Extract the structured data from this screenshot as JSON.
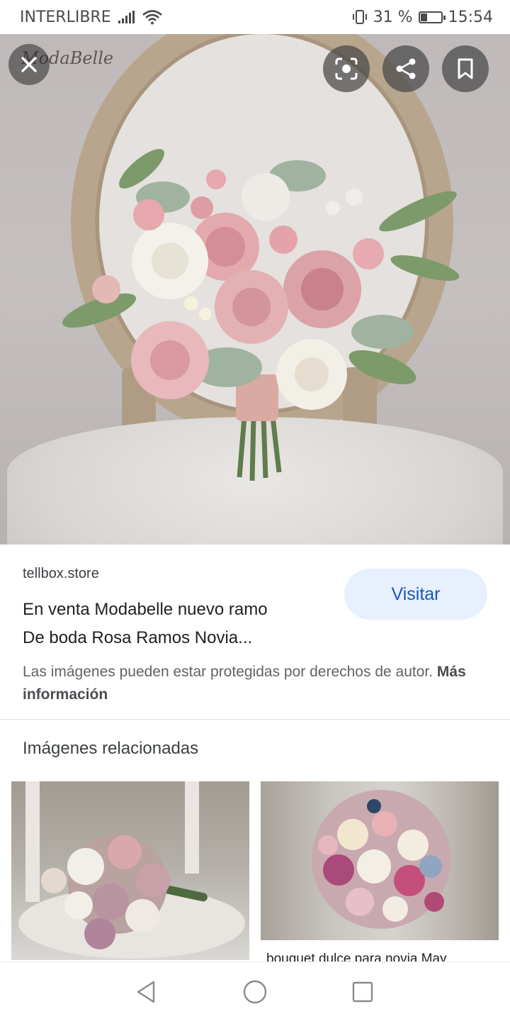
{
  "status_bar": {
    "carrier": "INTERLIBRE",
    "battery_percent": "31 %",
    "battery_level": 0.31,
    "time": "15:54",
    "icons": [
      "signal-icon",
      "wifi-icon",
      "vibrate-icon",
      "battery-icon"
    ]
  },
  "viewer": {
    "watermark": "ModaBelle",
    "buttons": [
      "close-icon",
      "lens-icon",
      "share-icon",
      "bookmark-icon"
    ]
  },
  "result": {
    "source": "tellbox.store",
    "title_line1": "En venta Modabelle nuevo ramo",
    "title_line2": "De boda Rosa Ramos Novia...",
    "visit_label": "Visitar",
    "copyright_text": "Las imágenes pueden estar protegidas por derechos de autor.",
    "more_info": "Más información"
  },
  "related": {
    "heading": "Imágenes relacionadas",
    "items": [
      {
        "caption": ""
      },
      {
        "caption": "bouquet dulce para novia May"
      }
    ]
  },
  "colors": {
    "accent": "#1a56b8",
    "visit_bg": "#e8f0fe",
    "rose_pink": "#d9a3a6",
    "ivory": "#f3efe6",
    "greenery": "#6f8f5d"
  },
  "nav_bar": {
    "buttons": [
      "back-icon",
      "home-icon",
      "recents-icon"
    ]
  }
}
